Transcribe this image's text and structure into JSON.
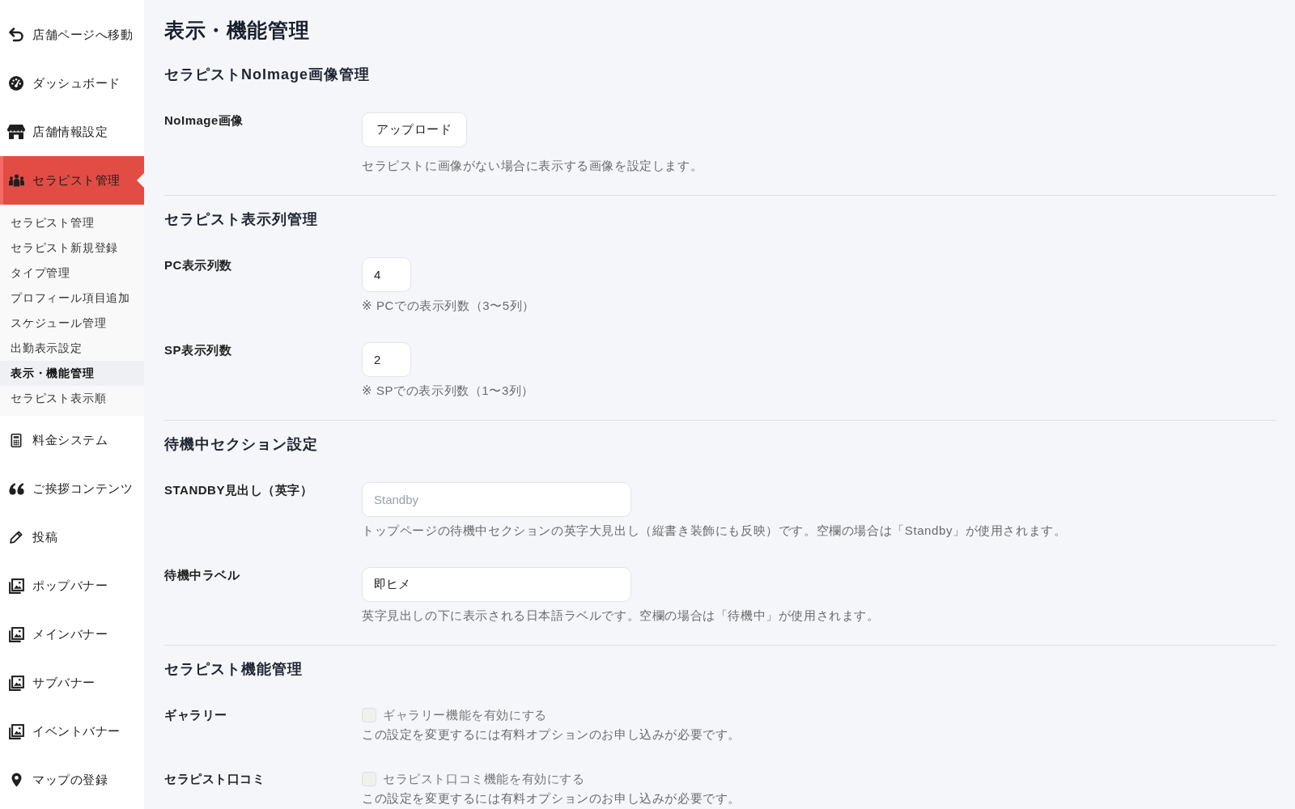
{
  "sidebar": {
    "items": [
      {
        "label": "店舗ページへ移動",
        "selected": false
      },
      {
        "label": "ダッシュボード",
        "selected": false
      },
      {
        "label": "店舗情報設定",
        "selected": false
      },
      {
        "label": "セラピスト管理",
        "selected": true,
        "children": [
          {
            "label": "セラピスト管理",
            "selected": false
          },
          {
            "label": "セラピスト新規登録",
            "selected": false
          },
          {
            "label": "タイプ管理",
            "selected": false
          },
          {
            "label": "プロフィール項目追加",
            "selected": false
          },
          {
            "label": "スケジュール管理",
            "selected": false
          },
          {
            "label": "出勤表示設定",
            "selected": false
          },
          {
            "label": "表示・機能管理",
            "selected": true
          },
          {
            "label": "セラピスト表示順",
            "selected": false
          }
        ]
      },
      {
        "label": "料金システム",
        "selected": false
      },
      {
        "label": "ご挨拶コンテンツ",
        "selected": false
      },
      {
        "label": "投稿",
        "selected": false
      },
      {
        "label": "ポップバナー",
        "selected": false
      },
      {
        "label": "メインバナー",
        "selected": false
      },
      {
        "label": "サブバナー",
        "selected": false
      },
      {
        "label": "イベントバナー",
        "selected": false
      },
      {
        "label": "マップの登録",
        "selected": false
      }
    ]
  },
  "page": {
    "title": "表示・機能管理"
  },
  "sections": [
    {
      "heading": "セラピストNoImage画像管理",
      "rows": [
        {
          "kind": "upload",
          "label": "NoImage画像",
          "button": "アップロード",
          "help": "セラピストに画像がない場合に表示する画像を設定します。"
        }
      ]
    },
    {
      "heading": "セラピスト表示列管理",
      "rows": [
        {
          "kind": "number",
          "label": "PC表示列数",
          "value": "4",
          "help": "※ PCでの表示列数（3〜5列）"
        },
        {
          "kind": "number",
          "label": "SP表示列数",
          "value": "2",
          "help": "※ SPでの表示列数（1〜3列）"
        }
      ]
    },
    {
      "heading": "待機中セクション設定",
      "rows": [
        {
          "kind": "text",
          "label": "STANDBY見出し（英字）",
          "placeholder": "Standby",
          "help": "トップページの待機中セクションの英字大見出し（縦書き装飾にも反映）です。空欄の場合は「Standby」が使用されます。"
        },
        {
          "kind": "text",
          "label": "待機中ラベル",
          "value": "即ヒメ",
          "help": "英字見出しの下に表示される日本語ラベルです。空欄の場合は「待機中」が使用されます。"
        }
      ]
    },
    {
      "heading": "セラピスト機能管理",
      "rows": [
        {
          "kind": "checkbox",
          "label": "ギャラリー",
          "option": "ギャラリー機能を有効にする",
          "checked": false,
          "disabled": true,
          "help": "この設定を変更するには有料オプションのお申し込みが必要です。"
        },
        {
          "kind": "checkbox",
          "label": "セラピスト口コミ",
          "option": "セラピスト口コミ機能を有効にする",
          "checked": false,
          "disabled": true,
          "help": "この設定を変更するには有料オプションのお申し込みが必要です。"
        }
      ]
    }
  ]
}
